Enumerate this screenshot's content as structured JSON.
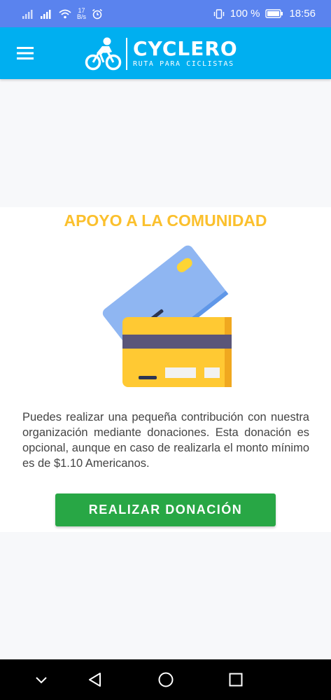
{
  "status_bar": {
    "speed_value": "17",
    "speed_unit": "B/s",
    "battery": "100 %",
    "time": "18:56"
  },
  "app_bar": {
    "logo_title": "CYCLERO",
    "logo_subtitle": "RUTA PARA CICLISTAS"
  },
  "main": {
    "heading": "APOYO A LA COMUNIDAD",
    "description": "Puedes realizar una pequeña contribución con nuestra organización mediante donaciones. Esta donación es opcional, aunque en caso de realizarla el monto mínimo es de $1.10 Americanos.",
    "donate_button": "REALIZAR DONACIÓN"
  },
  "colors": {
    "status_bar": "#5a83ee",
    "app_bar": "#00aff0",
    "heading": "#fbc02d",
    "button": "#28a745"
  },
  "icons": [
    "signal-icon",
    "wifi-icon",
    "alarm-icon",
    "vibrate-icon",
    "battery-icon",
    "menu-icon",
    "cyclist-logo-icon",
    "back-icon",
    "home-icon",
    "recents-icon",
    "chevron-down-icon"
  ]
}
